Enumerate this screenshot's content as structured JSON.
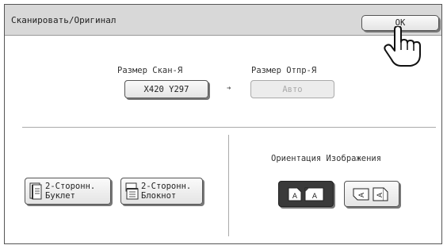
{
  "header": {
    "title": "Сканировать/Оригинал",
    "ok_label": "OK"
  },
  "scan_size": {
    "label": "Размер Скан-Я",
    "value": "X420  Y297"
  },
  "send_size": {
    "label": "Размер Отпр-Я",
    "value": "Авто"
  },
  "duplex": {
    "booklet_label": "2-Сторонн.\nБуклет",
    "tablet_label": "2-Сторонн.\nБлокнот"
  },
  "orientation": {
    "label": "Ориентация Изображения",
    "selected": "portrait"
  },
  "icons": {
    "arrow": "right-arrow-icon",
    "pointer": "hand-pointer-icon",
    "booklet": "booklet-icon",
    "tablet": "tablet-icon",
    "portrait": "portrait-orientation-icon",
    "landscape": "landscape-orientation-icon"
  }
}
